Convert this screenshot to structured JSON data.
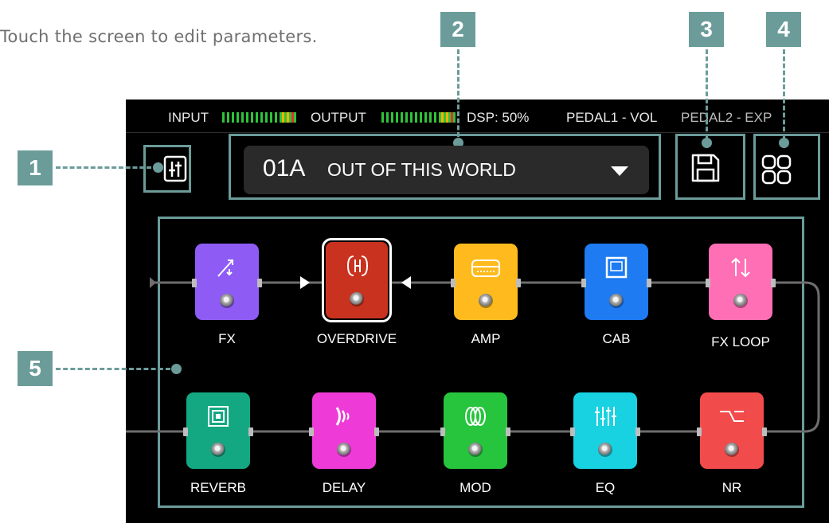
{
  "instruction": "Touch the screen to edit parameters.",
  "callouts": [
    "1",
    "2",
    "3",
    "4",
    "5"
  ],
  "status": {
    "input_label": "INPUT",
    "output_label": "OUTPUT",
    "dsp": "DSP:  50%",
    "pedal1": "PEDAL1 - VOL",
    "pedal2": "PEDAL2 - EXP"
  },
  "preset": {
    "number": "01A",
    "name": "OUT OF THIS WORLD"
  },
  "icons": {
    "mixer": "mixer-sliders-icon",
    "save": "floppy-disk-icon",
    "grid": "grid-icon"
  },
  "chain_row1": [
    {
      "label": "FX",
      "color": "#8e5cf5",
      "icon": "diagonal-arrow-icon"
    },
    {
      "label": "OVERDRIVE",
      "color": "#c9321f",
      "icon": "bracket-icon",
      "selected": true
    },
    {
      "label": "AMP",
      "color": "#ffbb1e",
      "icon": "amp-head-icon"
    },
    {
      "label": "CAB",
      "color": "#1e7bf2",
      "icon": "cabinet-icon"
    },
    {
      "label": "FX LOOP",
      "color": "#ff6fb5",
      "icon": "up-down-arrows-icon"
    }
  ],
  "chain_row2": [
    {
      "label": "REVERB",
      "color": "#14a882",
      "icon": "concentric-squares-icon"
    },
    {
      "label": "DELAY",
      "color": "#ee3bd8",
      "icon": "delay-waves-icon"
    },
    {
      "label": "MOD",
      "color": "#27c43e",
      "icon": "modulation-loops-icon"
    },
    {
      "label": "EQ",
      "color": "#18d2e2",
      "icon": "eq-sliders-icon"
    },
    {
      "label": "NR",
      "color": "#f24b4b",
      "icon": "noise-gate-icon"
    }
  ]
}
